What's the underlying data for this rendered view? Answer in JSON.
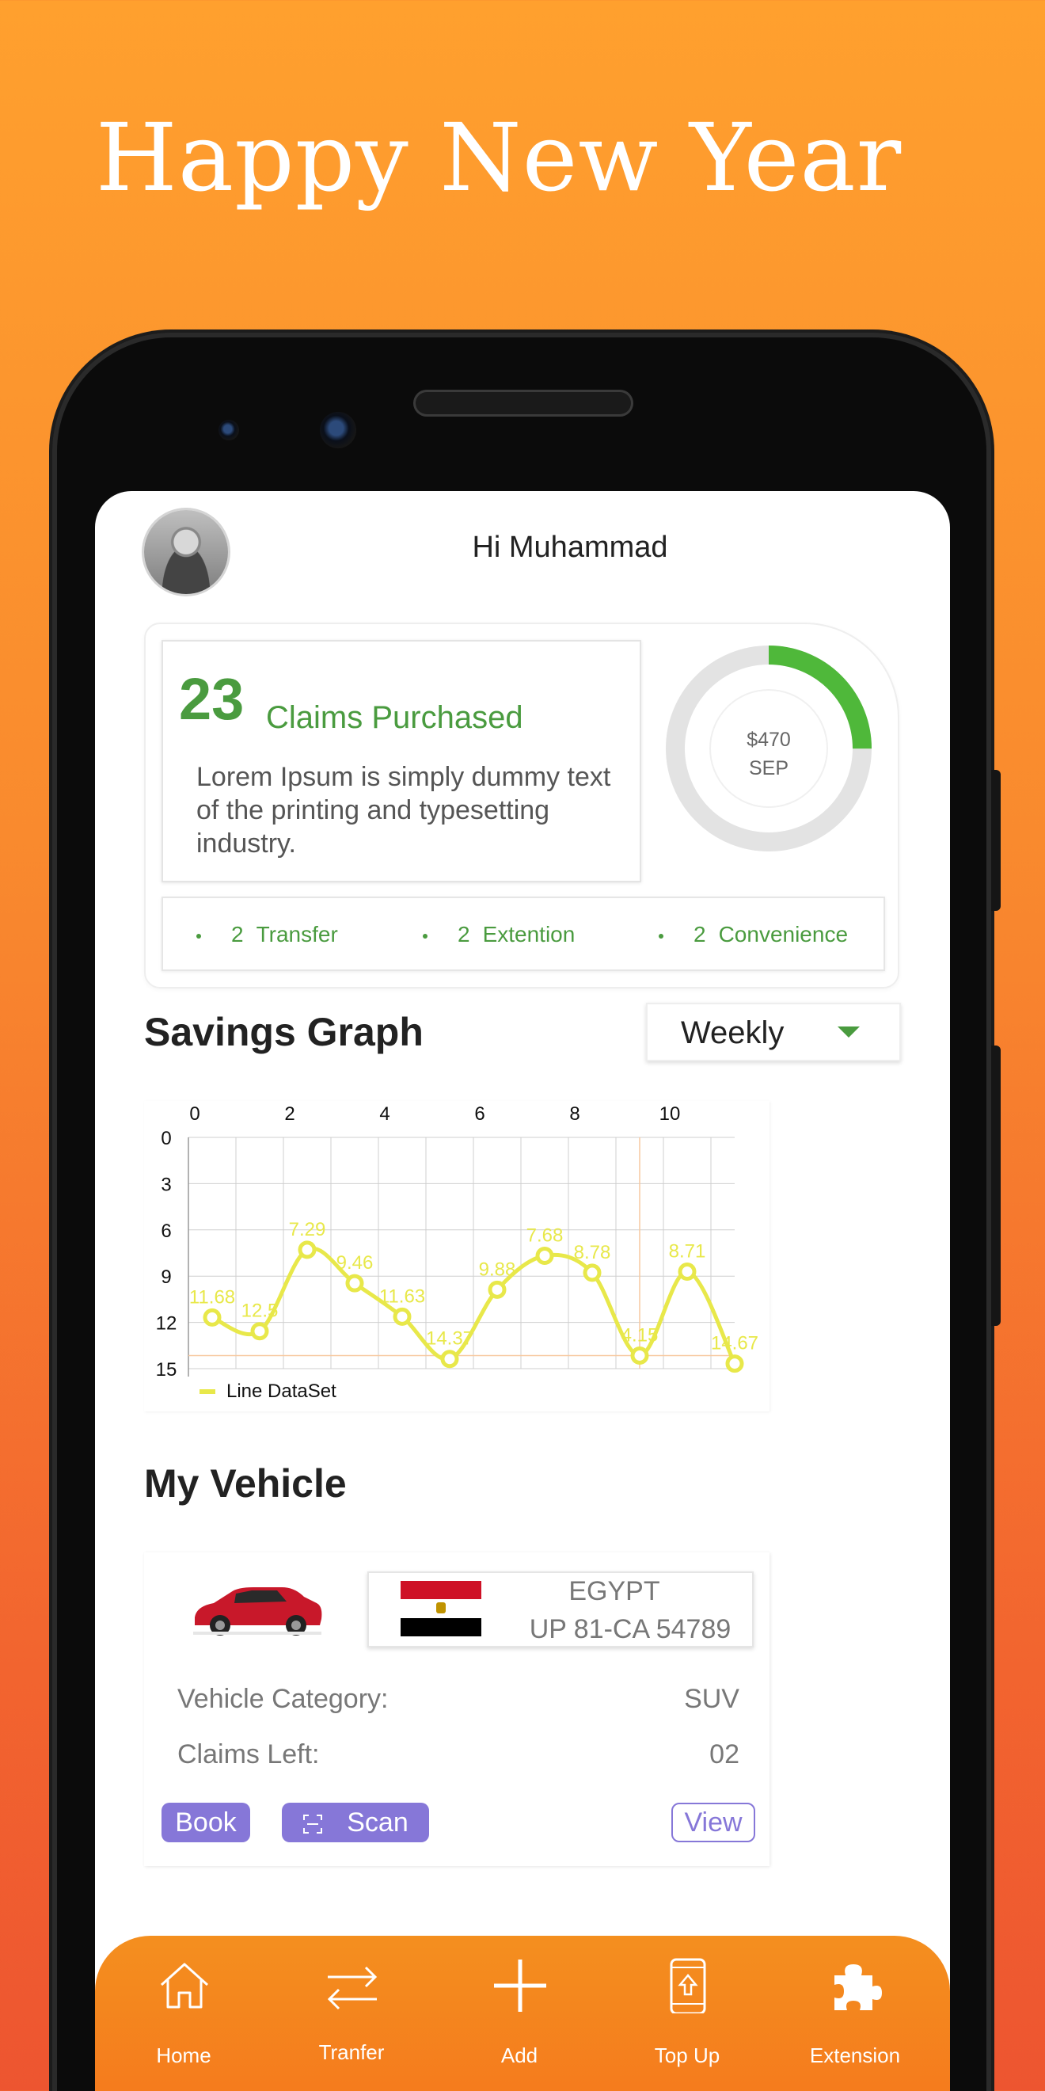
{
  "headline": "Happy New Year",
  "header": {
    "greeting": "Hi Muhammad"
  },
  "summary": {
    "claims_count": "23",
    "claims_label": "Claims Purchased",
    "description": "Lorem Ipsum is simply dummy text of the printing and typesetting industry.",
    "donut": {
      "amount": "$470",
      "month": "SEP",
      "fraction": 0.25,
      "color": "#4fb83a",
      "track": "#e3e3e3"
    },
    "chips": [
      {
        "count": "2",
        "label": "Transfer"
      },
      {
        "count": "2",
        "label": "Extention"
      },
      {
        "count": "2",
        "label": "Convenience"
      }
    ]
  },
  "savings": {
    "title": "Savings Graph",
    "period": "Weekly"
  },
  "chart_data": {
    "type": "line",
    "series": [
      {
        "name": "Line DataSet",
        "x": [
          0.5,
          1.5,
          2.5,
          3.5,
          4.5,
          5.5,
          6.5,
          7.5,
          8.5,
          9.5,
          10.5,
          11.5
        ],
        "values": [
          11.68,
          12.57,
          7.29,
          9.46,
          11.63,
          14.37,
          9.88,
          7.68,
          8.78,
          14.15,
          8.71,
          14.67
        ],
        "labels": [
          "11.68",
          "12.5",
          "7.29",
          "9.46",
          "11.63",
          "14.37",
          "9.88",
          "7.68",
          "8.78",
          "4.15",
          "8.71",
          "14.67"
        ],
        "color": "#e8e84a"
      }
    ],
    "x_ticks": [
      "0",
      "2",
      "4",
      "6",
      "8",
      "10"
    ],
    "y_ticks": [
      "0",
      "3",
      "6",
      "9",
      "12",
      "15"
    ],
    "xlim": [
      0,
      11.5
    ],
    "ylim": [
      0,
      15
    ],
    "y_inverted": true,
    "x_axis_position": "top",
    "grid": true,
    "highlight": {
      "x": 9.5,
      "y": 14.15,
      "color": "#f7c9a0"
    },
    "legend_position": "bottom-left"
  },
  "vehicle": {
    "title": "My Vehicle",
    "country": "EGYPT",
    "plate": "UP 81-CA 54789",
    "category_label": "Vehicle Category:",
    "category_value": "SUV",
    "claims_left_label": "Claims Left:",
    "claims_left_value": "02",
    "book_label": "Book",
    "scan_label": "Scan",
    "view_label": "View",
    "car_color": "#c8182a"
  },
  "tabbar": {
    "items": [
      {
        "label": "Home",
        "icon": "home-icon"
      },
      {
        "label": "Tranfer",
        "icon": "transfer-icon"
      },
      {
        "label": "Add",
        "icon": "plus-icon"
      },
      {
        "label": "Top Up",
        "icon": "top-up-phone-icon"
      },
      {
        "label": "Extension",
        "icon": "puzzle-icon"
      }
    ]
  }
}
